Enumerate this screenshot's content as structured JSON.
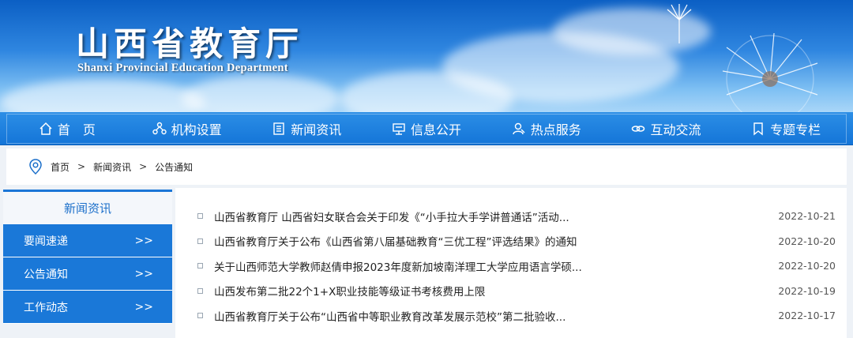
{
  "header": {
    "title_cn": "山西省教育厅",
    "title_en": "Shanxi Provincial Education Department"
  },
  "nav": [
    {
      "label": "首　页",
      "icon": "home-icon"
    },
    {
      "label": "机构设置",
      "icon": "org-icon"
    },
    {
      "label": "新闻资讯",
      "icon": "document-icon"
    },
    {
      "label": "信息公开",
      "icon": "info-board-icon"
    },
    {
      "label": "热点服务",
      "icon": "user-service-icon"
    },
    {
      "label": "互动交流",
      "icon": "link-icon"
    },
    {
      "label": "专题专栏",
      "icon": "bookmark-icon"
    }
  ],
  "breadcrumb": {
    "items": [
      "首页",
      "新闻资讯",
      "公告通知"
    ],
    "separator": ">"
  },
  "sidebar": {
    "heading": "新闻资讯",
    "items": [
      {
        "label": "要闻速递",
        "arrow": ">>"
      },
      {
        "label": "公告通知",
        "arrow": ">>"
      },
      {
        "label": "工作动态",
        "arrow": ">>"
      }
    ]
  },
  "news": [
    {
      "title": "山西省教育厅 山西省妇女联合会关于印发《“小手拉大手学讲普通话”活动...",
      "date": "2022-10-21"
    },
    {
      "title": "山西省教育厅关于公布《山西省第八届基础教育“三优工程”评选结果》的通知",
      "date": "2022-10-20"
    },
    {
      "title": "关于山西师范大学教师赵倩申报2023年度新加坡南洋理工大学应用语言学硕...",
      "date": "2022-10-20"
    },
    {
      "title": "山西发布第二批22个1+X职业技能等级证书考核费用上限",
      "date": "2022-10-19"
    },
    {
      "title": "山西省教育厅关于公布“山西省中等职业教育改革发展示范校”第二批验收...",
      "date": "2022-10-17"
    }
  ],
  "colors": {
    "nav_bg": "#1a78d8",
    "sidebar_item_bg": "#1a78d8",
    "sidebar_heading_text": "#1b6fca"
  }
}
